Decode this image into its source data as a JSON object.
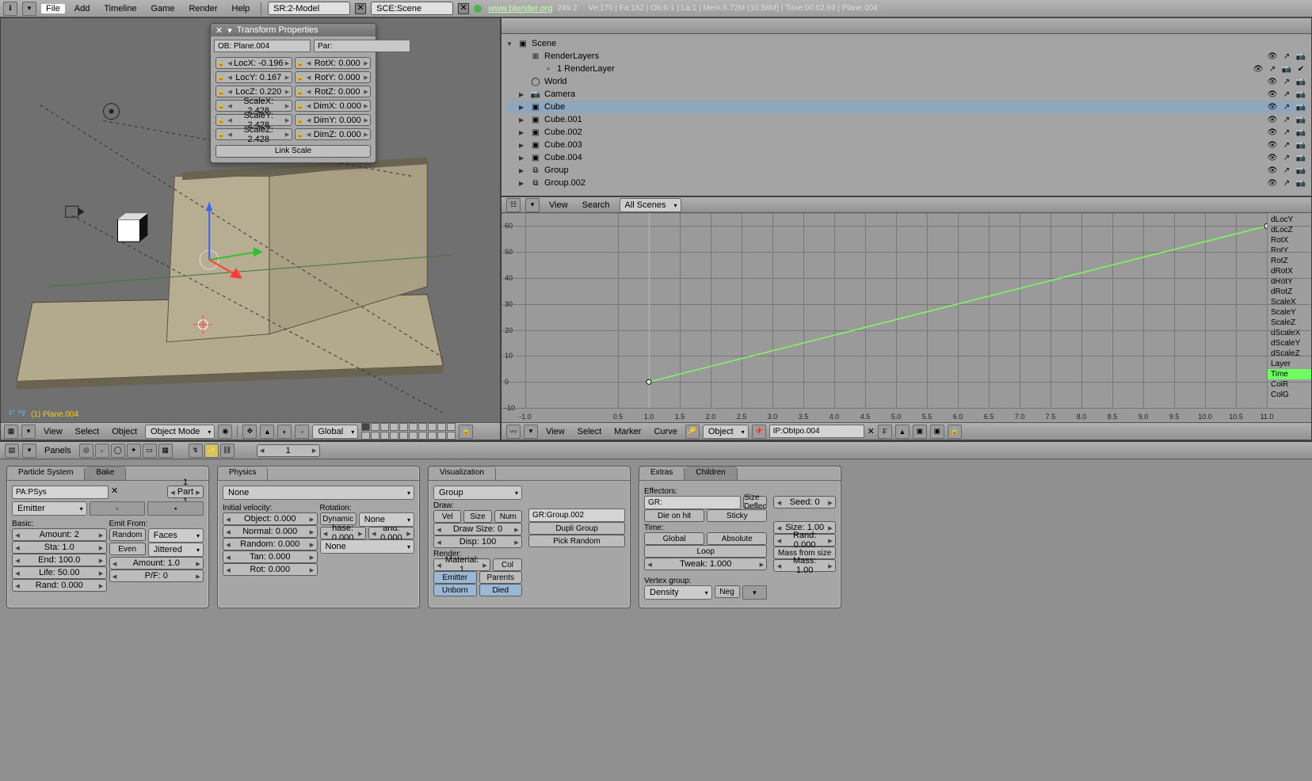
{
  "header": {
    "menus": [
      "File",
      "Add",
      "Timeline",
      "Game",
      "Render",
      "Help"
    ],
    "screen_field_label": "SR:2-Model",
    "scene_field_label": "SCE:Scene",
    "url": "www.blender.org",
    "version": "249.2",
    "stats": "Ve:170 | Fa:182 | Ob:6-1 | La:1 | Mem:6.72M (10.58M) | Time:00:02.69 | Plane.004"
  },
  "transform_panel": {
    "title": "Transform Properties",
    "ob_label": "OB: Plane.004",
    "par_label": "Par:",
    "rows": [
      {
        "a": "LocX: -0.196",
        "b": "RotX: 0.000"
      },
      {
        "a": "LocY: 0.167",
        "b": "RotY: 0.000"
      },
      {
        "a": "LocZ: 0.220",
        "b": "RotZ: 0.000"
      },
      {
        "a": "ScaleX: 2.428",
        "b": "DimX: 0.000"
      },
      {
        "a": "ScaleY: 2.428",
        "b": "DimY: 0.000"
      },
      {
        "a": "ScaleZ: 2.428",
        "b": "DimZ: 0.000"
      }
    ],
    "link_scale": "Link Scale"
  },
  "view3d": {
    "object_name": "(1) Plane.004",
    "menus": [
      "View",
      "Select",
      "Object"
    ],
    "mode": "Object Mode",
    "orient": "Global"
  },
  "outliner": {
    "root": "Scene",
    "items": [
      {
        "icon": "⊞",
        "label": "RenderLayers",
        "indent": 1
      },
      {
        "icon": "▫",
        "label": "1 RenderLayer",
        "indent": 2,
        "check": true
      },
      {
        "icon": "◯",
        "label": "World",
        "indent": 1
      },
      {
        "icon": "📷",
        "label": "Camera",
        "indent": 1,
        "tri": "▶"
      },
      {
        "icon": "▣",
        "label": "Cube",
        "indent": 1,
        "tri": "▶",
        "sel": true
      },
      {
        "icon": "▣",
        "label": "Cube.001",
        "indent": 1,
        "tri": "▶"
      },
      {
        "icon": "▣",
        "label": "Cube.002",
        "indent": 1,
        "tri": "▶"
      },
      {
        "icon": "▣",
        "label": "Cube.003",
        "indent": 1,
        "tri": "▶"
      },
      {
        "icon": "▣",
        "label": "Cube.004",
        "indent": 1,
        "tri": "▶"
      },
      {
        "icon": "⧉",
        "label": "Group",
        "indent": 1,
        "tri": "▶"
      },
      {
        "icon": "⧉",
        "label": "Group.002",
        "indent": 1,
        "tri": "▶"
      }
    ]
  },
  "graph": {
    "top_menus": [
      "View",
      "Search"
    ],
    "scene_filter": "All Scenes",
    "bottom_menus": [
      "View",
      "Select",
      "Marker",
      "Curve"
    ],
    "ipo_type": "Object",
    "ip_field": "IP:ObIpo.004",
    "frame_btn": "F",
    "channels": [
      "dLocY",
      "dLocZ",
      "RotX",
      "RotY",
      "RotZ",
      "dRotX",
      "dRotY",
      "dRotZ",
      "ScaleX",
      "ScaleY",
      "ScaleZ",
      "dScaleX",
      "dScaleY",
      "dScaleZ",
      "Layer",
      "Time",
      "ColR",
      "ColG"
    ],
    "active_channel": "Time"
  },
  "chart_data": {
    "type": "line",
    "title": "",
    "xlabel": "",
    "ylabel": "",
    "xlim": [
      -1.0,
      11.0
    ],
    "ylim": [
      -10,
      65
    ],
    "x_ticks": [
      -1.0,
      0.5,
      1.0,
      1.5,
      2.0,
      2.5,
      3.0,
      3.5,
      4.0,
      4.5,
      5.0,
      5.5,
      6.0,
      6.5,
      7.0,
      7.5,
      8.0,
      8.5,
      9.0,
      9.5,
      10.0,
      10.5,
      11.0
    ],
    "y_ticks": [
      -10,
      0,
      10,
      20,
      30,
      40,
      50,
      60
    ],
    "current_frame": 1.0,
    "series": [
      {
        "name": "Time",
        "color": "#7bff5a",
        "x": [
          1.0,
          11.0
        ],
        "y": [
          0.0,
          60.0
        ]
      }
    ]
  },
  "buttons_header": {
    "label": "Panels",
    "frame": "1"
  },
  "particle_panel": {
    "tab1": "Particle System",
    "tab2": "Bake",
    "pa_field": "PA:PSys",
    "part_nav": "1 Part 1",
    "type": "Emitter",
    "basic_label": "Basic:",
    "emit_from_label": "Emit From:",
    "amount": "Amount: 2",
    "sta": "Sta: 1.0",
    "end": "End: 100.0",
    "life": "Life: 50.00",
    "rand": "Rand: 0.000",
    "random_btn": "Random",
    "faces_btn": "Faces",
    "even_btn": "Even",
    "jittered_btn": "Jittered",
    "amount2": "Amount: 1.0",
    "pf": "P/F: 0"
  },
  "physics_panel": {
    "tab": "Physics",
    "type": "None",
    "ivel_label": "Initial velocity:",
    "object": "Object: 0.000",
    "normal": "Normal: 0.000",
    "random": "Random: 0.000",
    "tan": "Tan: 0.000",
    "rot": "Rot: 0.000",
    "rotation_label": "Rotation:",
    "dynamic": "Dynamic",
    "none1": "None",
    "phase": "hase: 0.000",
    "and": "and: 0.000",
    "none2": "None"
  },
  "viz_panel": {
    "tab": "Visualization",
    "group": "Group",
    "draw_label": "Draw:",
    "vel": "Vel",
    "size": "Size",
    "num": "Num",
    "draw_size": "Draw Size: 0",
    "disp": "Disp: 100",
    "render_label": "Render:",
    "material": "Material: 1",
    "col": "Col",
    "emitter": "Emitter",
    "parents": "Parents",
    "unborn": "Unborn",
    "died": "Died",
    "gr": "GR:Group.002",
    "dupli": "Dupli Group",
    "pick": "Pick Random"
  },
  "extras_panel": {
    "tab1": "Extras",
    "tab2": "Children",
    "effectors_label": "Effectors:",
    "gr": "GR:",
    "size_deflect": "Size Deflec",
    "die": "Die on hit",
    "sticky": "Sticky",
    "time_label": "Time:",
    "global": "Global",
    "absolute": "Absolute",
    "loop": "Loop",
    "tweak": "Tweak: 1.000",
    "seed": "Seed: 0",
    "size": "Size: 1.00",
    "rand": "Rand: 0.000",
    "massfs": "Mass from size",
    "mass": "Mass: 1.00",
    "vgroup_label": "Vertex group:",
    "vgroup": "Density",
    "neg": "Neg"
  }
}
